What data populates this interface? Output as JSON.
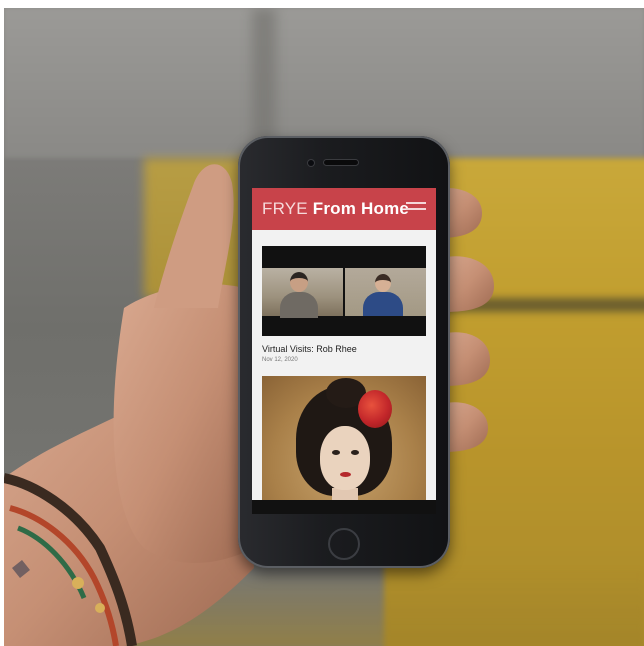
{
  "phone_screen": {
    "app_bar": {
      "brand_light": "FRYE",
      "brand_bold": "From Home",
      "menu_icon": "hamburger-menu-icon",
      "color": "#c8434a"
    },
    "cards": [
      {
        "title": "Virtual Visits: Rob Rhee",
        "date": "Nov 12, 2020"
      }
    ]
  }
}
